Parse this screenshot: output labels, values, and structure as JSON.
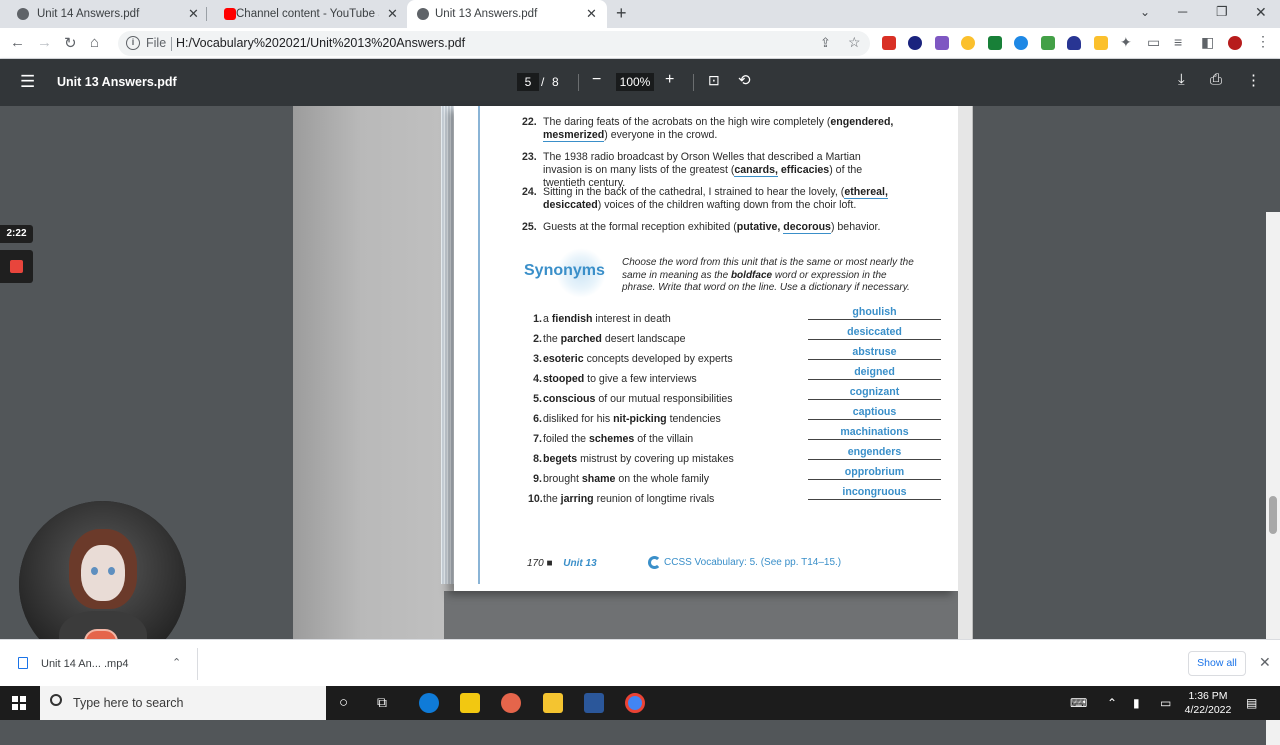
{
  "tabs": [
    {
      "title": "Unit 14 Answers.pdf",
      "active": false
    },
    {
      "title": "Channel content - YouTube Studio",
      "active": false
    },
    {
      "title": "Unit 13 Answers.pdf",
      "active": true
    }
  ],
  "address": {
    "scheme": "File",
    "url": "H:/Vocabulary%202021/Unit%2013%20Answers.pdf"
  },
  "pdf": {
    "title": "Unit 13 Answers.pdf",
    "page_current": "5",
    "page_sep": "/",
    "page_total": "8",
    "zoom": "100%"
  },
  "questions": [
    {
      "num": "22.",
      "pre": "The daring feats of the acrobats on the high wire completely (",
      "opt1": "engendered,",
      "opt2": "mesmerized",
      "post": ") everyone in the crowd.",
      "answer": 2
    },
    {
      "num": "23.",
      "pre": "The 1938 radio broadcast by Orson Welles that described a Martian invasion is on many lists of the greatest (",
      "opt1": "canards,",
      "opt2": "efficacies",
      "post": ") of the twentieth century.",
      "answer": 1
    },
    {
      "num": "24.",
      "pre": "Sitting in the back of the cathedral, I strained to hear the lovely, (",
      "opt1": "ethereal,",
      "opt2": "desiccated",
      "post": ") voices of the children wafting down from the choir loft.",
      "answer": 1
    },
    {
      "num": "25.",
      "pre": "Guests at the formal reception exhibited (",
      "opt1": "putative,",
      "opt2": "decorous",
      "post": ") behavior.",
      "answer": 2
    }
  ],
  "synonyms": {
    "heading": "Synonyms",
    "instructions_pre": "Choose the word from this unit that is the same or most nearly the same in meaning as the ",
    "instructions_bold": "boldface",
    "instructions_post": " word or expression in the phrase. Write that word on the line. Use a dictionary if necessary.",
    "items": [
      {
        "num": "1.",
        "pre": "a ",
        "bold": "fiendish",
        "post": " interest in death",
        "answer": "ghoulish"
      },
      {
        "num": "2.",
        "pre": "the ",
        "bold": "parched",
        "post": " desert landscape",
        "answer": "desiccated"
      },
      {
        "num": "3.",
        "pre": "",
        "bold": "esoteric",
        "post": " concepts developed by experts",
        "answer": "abstruse"
      },
      {
        "num": "4.",
        "pre": "",
        "bold": "stooped",
        "post": " to give a few interviews",
        "answer": "deigned"
      },
      {
        "num": "5.",
        "pre": "",
        "bold": "conscious",
        "post": " of our mutual responsibilities",
        "answer": "cognizant"
      },
      {
        "num": "6.",
        "pre": "disliked for his ",
        "bold": "nit-picking",
        "post": " tendencies",
        "answer": "captious"
      },
      {
        "num": "7.",
        "pre": "foiled the ",
        "bold": "schemes",
        "post": " of the villain",
        "answer": "machinations"
      },
      {
        "num": "8.",
        "pre": "",
        "bold": "begets",
        "post": " mistrust by covering up mistakes",
        "answer": "engenders"
      },
      {
        "num": "9.",
        "pre": "brought ",
        "bold": "shame",
        "post": " on the whole family",
        "answer": "opprobrium"
      },
      {
        "num": "10.",
        "pre": "the ",
        "bold": "jarring",
        "post": " reunion of longtime rivals",
        "answer": "incongruous"
      }
    ]
  },
  "footer": {
    "page": "170",
    "bullet": "■",
    "unit": "Unit 13",
    "ccss": "CCSS Vocabulary: 5. (See pp. T14–15.)"
  },
  "recorder": {
    "time": "2:22"
  },
  "download": {
    "filename": "Unit 14 An... .mp4",
    "show_all": "Show all"
  },
  "taskbar": {
    "search_placeholder": "Type here to search",
    "time": "1:36 PM",
    "date": "4/22/2022"
  }
}
